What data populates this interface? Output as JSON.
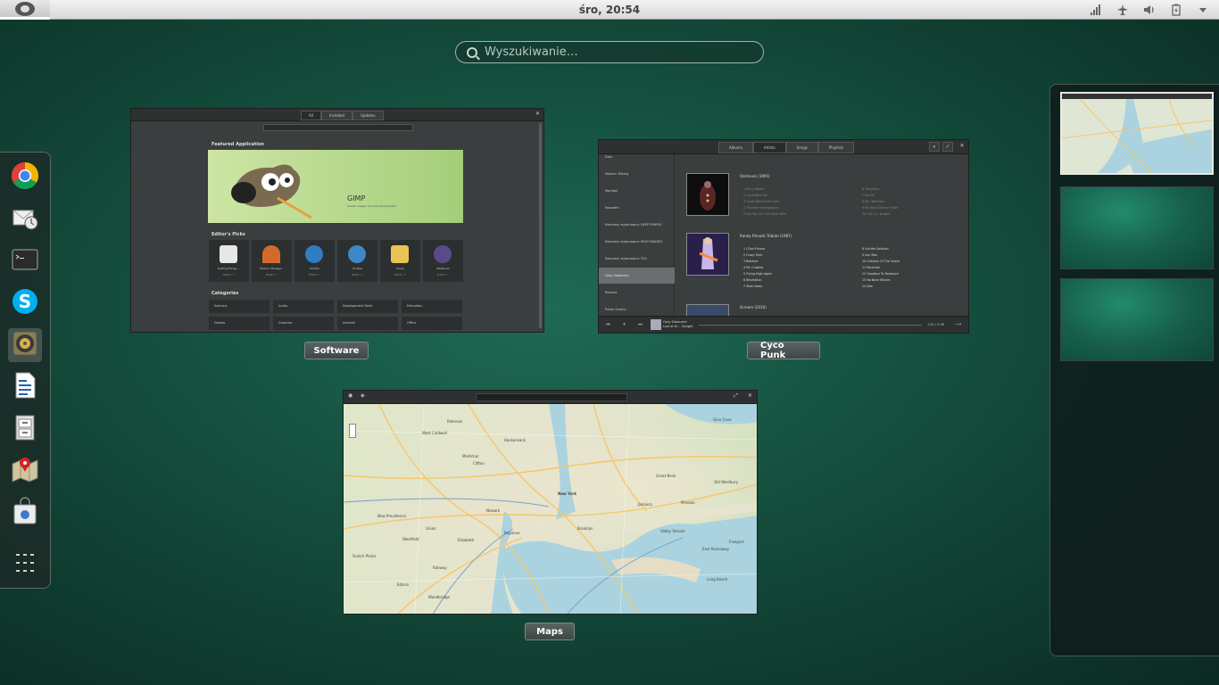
{
  "topbar": {
    "clock": "śro, 20:54",
    "tray_icons": [
      "network-signal-icon",
      "airplane-mode-icon",
      "volume-icon",
      "battery-icon",
      "menu-arrow-icon"
    ]
  },
  "search": {
    "placeholder": "Wyszukiwanie…"
  },
  "dash": {
    "items": [
      {
        "name": "chrome",
        "icon": "chrome-icon"
      },
      {
        "name": "evolution",
        "icon": "evolution-mail-icon"
      },
      {
        "name": "terminal",
        "icon": "terminal-icon"
      },
      {
        "name": "skype",
        "icon": "skype-icon"
      },
      {
        "name": "rhythmbox",
        "icon": "speaker-icon"
      },
      {
        "name": "writer",
        "icon": "document-icon"
      },
      {
        "name": "files",
        "icon": "file-cabinet-icon"
      },
      {
        "name": "maps",
        "icon": "maps-icon"
      },
      {
        "name": "software",
        "icon": "software-bag-icon"
      },
      {
        "name": "show-apps",
        "icon": "app-grid-icon"
      }
    ]
  },
  "windows": {
    "software": {
      "label": "Software",
      "tabs": [
        "All",
        "Installed",
        "Updates"
      ],
      "featured_heading": "Featured Application",
      "featured_name": "GIMP",
      "featured_desc": "Create images and edit photographs",
      "editors_heading": "Editor's Picks",
      "picks": [
        {
          "name": "Getting Things ...",
          "color": "#e7e7e7"
        },
        {
          "name": "Modern Manage...",
          "color": "#d46a2a"
        },
        {
          "name": "Shotter",
          "color": "#2f7ec2"
        },
        {
          "name": "Scribes",
          "color": "#3a88c7"
        },
        {
          "name": "Xiaoly",
          "color": "#e9c455"
        },
        {
          "name": "Stellarium",
          "color": "#5a4a8a"
        }
      ],
      "pick_stars": "★★★☆☆",
      "categories_heading": "Categories",
      "categories": [
        "Add-ons",
        "Audio",
        "Development Tools",
        "Education",
        "Games",
        "Graphics",
        "Internet",
        "Office"
      ]
    },
    "music": {
      "label": "Cyco Punk",
      "tabs": [
        "Albums",
        "Artists",
        "Songs",
        "Playlists"
      ],
      "artists": [
        "Dres",
        "Modern Talking",
        "Mordpol",
        "Nazareth",
        "Nieznany wykonawca: DEEP PURPLE",
        "Nieznany wykonawca: IRON MAIDEN",
        "Nieznany wykonawca: TSA",
        "Ozzy Osbourne",
        "Pantera",
        "Public Enemy"
      ],
      "selected_artist": "Ozzy Osbourne",
      "albums": [
        {
          "title": "Ozzmosis",
          "year": "(1995)",
          "tracks_left": [
            "1  Perry Mason",
            "2  I Just Want You",
            "3  Ghost Behind My Eyes",
            "4  Thunder Underground",
            "5  See You On The Other Side"
          ],
          "tracks_right": [
            "6  Tomorrow",
            "7  Denial",
            "8  My Little Man",
            "9  My Jekyll Doesn't Hide",
            "10 Old L.A. Tonight"
          ]
        },
        {
          "title": "Randy Rhoads Tribute",
          "year": "(1987)",
          "tracks_left": [
            "1  I Don't Know",
            "2  Crazy Train",
            "3  Believer",
            "4  Mr. Crowley",
            "5  Flying High Again",
            "6  Revelation",
            "7  Steal Away"
          ],
          "tracks_right": [
            "8  Suicide Solution",
            "9  Iron Man",
            "10 Children Of The Grave",
            "11 Paranoid",
            "12 Goodbye To Romance",
            "13 No Bone Movies",
            "14 Dee"
          ]
        },
        {
          "title": "Scream",
          "year": "(2010)"
        }
      ],
      "now_playing_artist": "Ozzy Osbourne",
      "now_playing_album": "Live at th... Tonight",
      "time": "1:52 / 5:39"
    },
    "maps": {
      "label": "Maps",
      "places": [
        "Glen Cove",
        "New York",
        "Paterson",
        "Hackensack",
        "West Caldwell",
        "Montclair",
        "Newark",
        "Elizabeth",
        "Union",
        "Bayonne",
        "Brooklyn",
        "Valley Stream",
        "Freeport",
        "East Rockaway",
        "Long Beach",
        "Westfield",
        "Rahway",
        "Edison",
        "Clifton",
        "Scotch Plains",
        "New Providence",
        "Old Westbury",
        "Jamaica",
        "Woodbridge",
        "Mineola",
        "Great Neck"
      ]
    }
  },
  "workspaces": {
    "count": 3,
    "active_index": 0
  }
}
